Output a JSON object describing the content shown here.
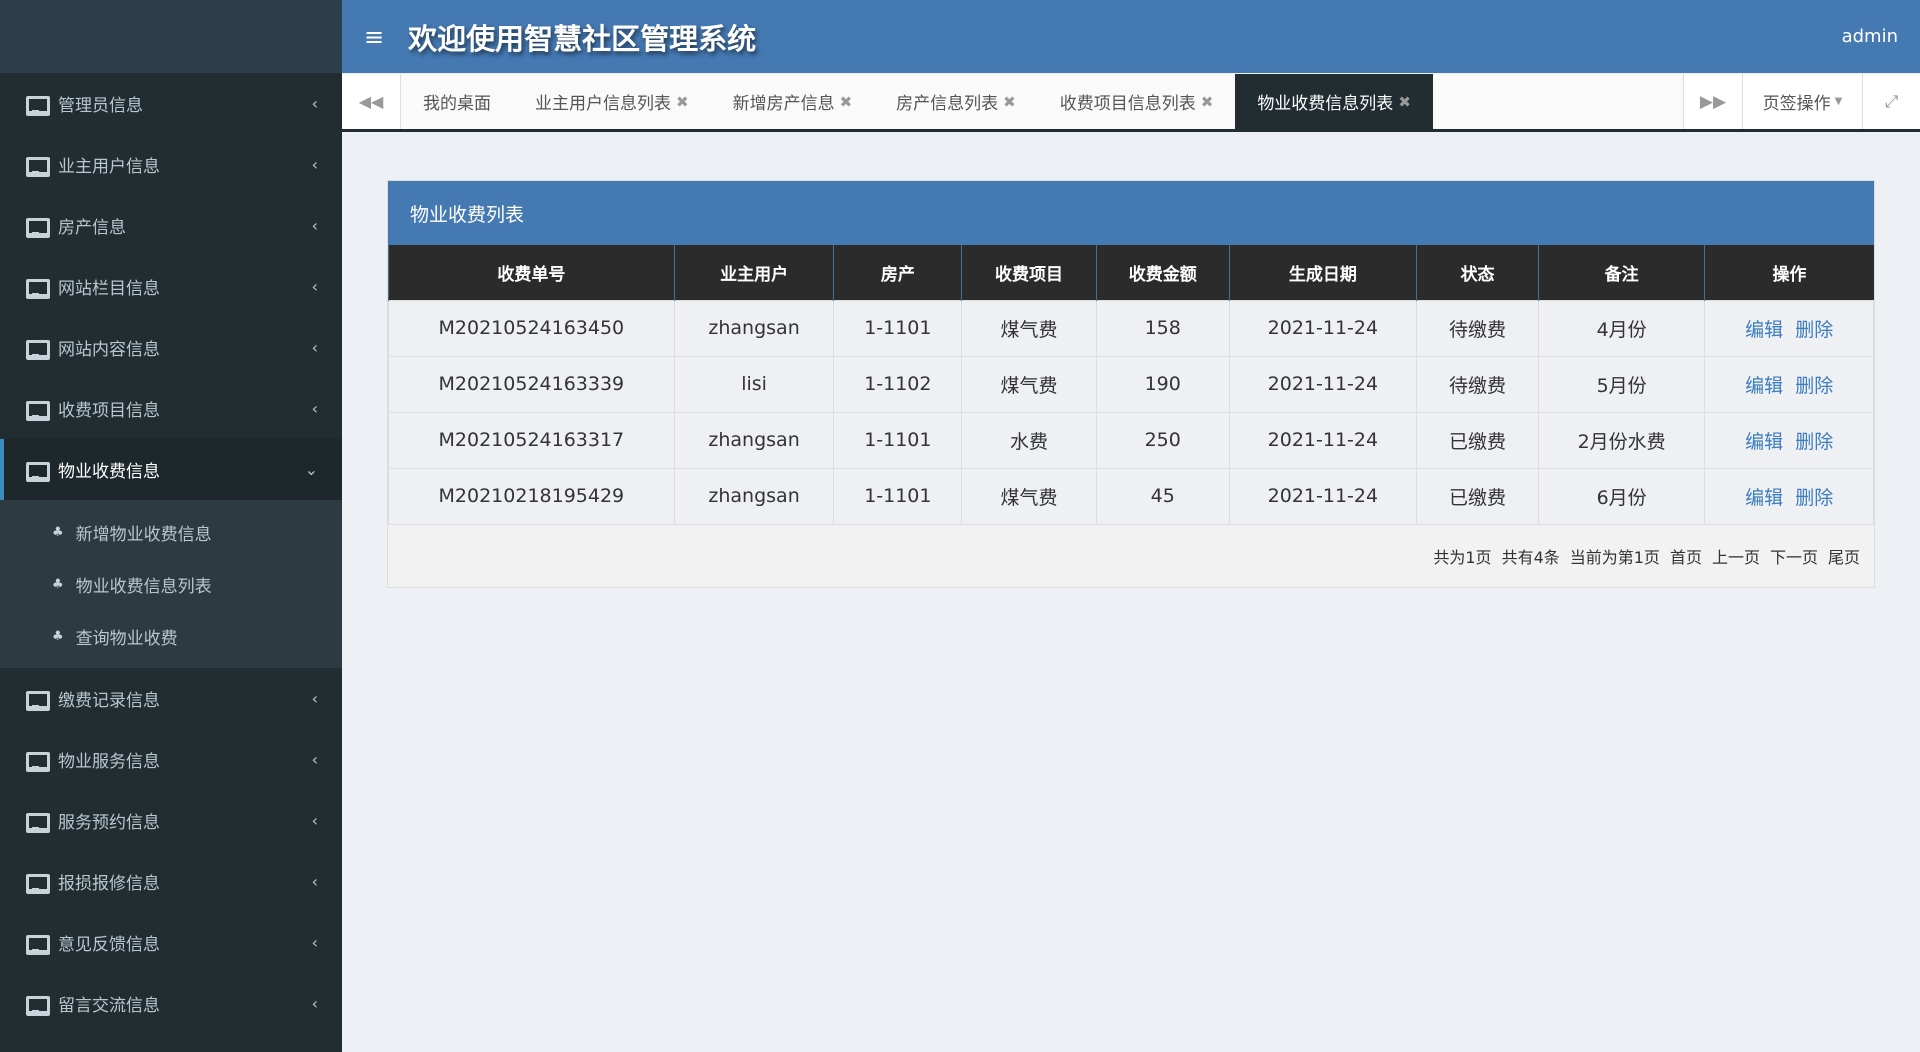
{
  "header": {
    "title": "欢迎使用智慧社区管理系统",
    "user": "admin"
  },
  "sidebar": {
    "items": [
      {
        "label": "管理员信息"
      },
      {
        "label": "业主用户信息"
      },
      {
        "label": "房产信息"
      },
      {
        "label": "网站栏目信息"
      },
      {
        "label": "网站内容信息"
      },
      {
        "label": "收费项目信息"
      },
      {
        "label": "物业收费信息",
        "active": true
      },
      {
        "label": "缴费记录信息"
      },
      {
        "label": "物业服务信息"
      },
      {
        "label": "服务预约信息"
      },
      {
        "label": "报损报修信息"
      },
      {
        "label": "意见反馈信息"
      },
      {
        "label": "留言交流信息"
      }
    ],
    "subitems": [
      {
        "label": "新增物业收费信息"
      },
      {
        "label": "物业收费信息列表"
      },
      {
        "label": "查询物业收费"
      }
    ]
  },
  "tabs": [
    {
      "label": "我的桌面"
    },
    {
      "label": "业主用户信息列表"
    },
    {
      "label": "新增房产信息"
    },
    {
      "label": "房产信息列表"
    },
    {
      "label": "收费项目信息列表"
    },
    {
      "label": "物业收费信息列表"
    }
  ],
  "tab_ops": "页签操作",
  "panel": {
    "title": "物业收费列表",
    "columns": [
      "收费单号",
      "业主用户",
      "房产",
      "收费项目",
      "收费金额",
      "生成日期",
      "状态",
      "备注",
      "操作"
    ],
    "rows": [
      [
        "M20210524163450",
        "zhangsan",
        "1-1101",
        "煤气费",
        "158",
        "2021-11-24",
        "待缴费",
        "4月份"
      ],
      [
        "M20210524163339",
        "lisi",
        "1-1102",
        "煤气费",
        "190",
        "2021-11-24",
        "待缴费",
        "5月份"
      ],
      [
        "M20210524163317",
        "zhangsan",
        "1-1101",
        "水费",
        "250",
        "2021-11-24",
        "已缴费",
        "2月份水费"
      ],
      [
        "M20210218195429",
        "zhangsan",
        "1-1101",
        "煤气费",
        "45",
        "2021-11-24",
        "已缴费",
        "6月份"
      ]
    ],
    "edit": "编辑",
    "delete": "删除",
    "pager": [
      "共为1页",
      "共有4条",
      "当前为第1页",
      "首页",
      "上一页",
      "下一页",
      "尾页"
    ]
  }
}
